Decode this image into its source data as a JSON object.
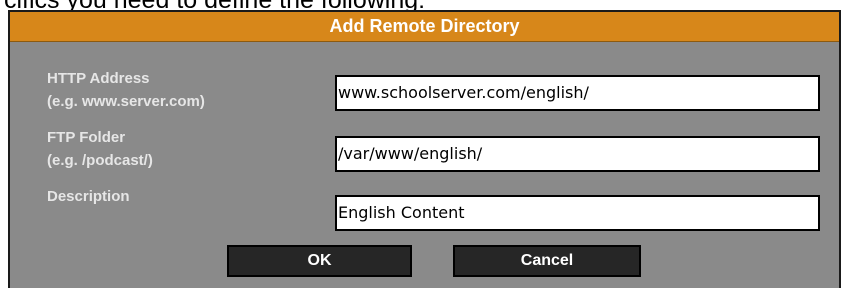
{
  "caption": "cifics you need to define the following:",
  "dialog": {
    "title": "Add Remote Directory",
    "fields": [
      {
        "label_line1": "HTTP Address",
        "label_line2": "(e.g. www.server.com)",
        "value": "www.schoolserver.com/english/"
      },
      {
        "label_line1": "FTP Folder",
        "label_line2": "(e.g. /podcast/)",
        "value": "/var/www/english/"
      },
      {
        "label_line1": "Description",
        "label_line2": "",
        "value": "English Content"
      }
    ],
    "buttons": {
      "ok": "OK",
      "cancel": "Cancel"
    }
  },
  "colors": {
    "titlebar": "#d7871a",
    "dialog_bg": "#8a8a8a",
    "label_text": "#e6e6e6",
    "button_bg": "#262626"
  }
}
